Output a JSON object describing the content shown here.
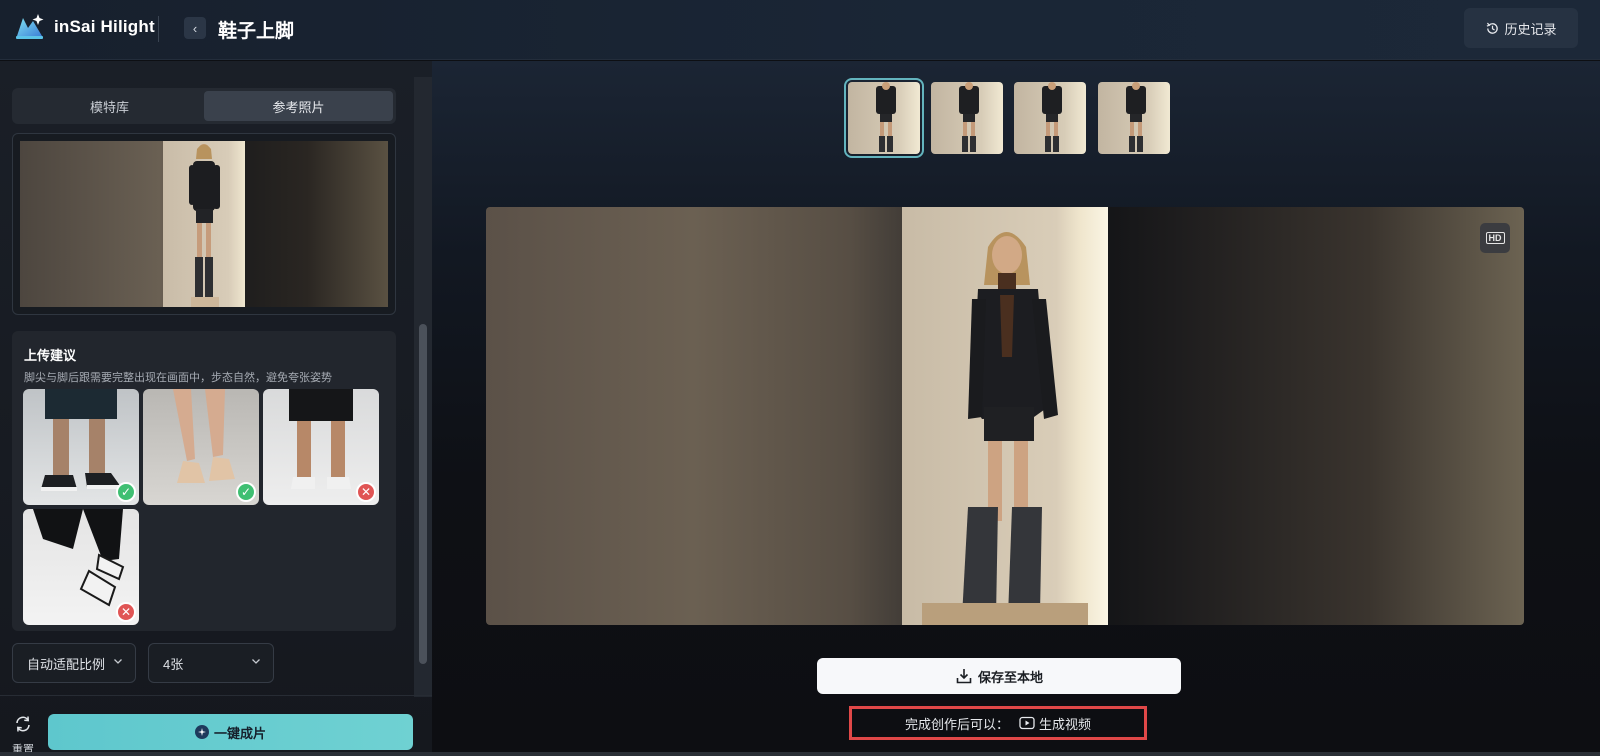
{
  "header": {
    "logo_text": "inSai Hilight",
    "back_icon": "chevron-left-icon",
    "title": "鞋子上脚",
    "history_label": "历史记录",
    "history_icon": "history-clock-icon"
  },
  "left": {
    "tabs": [
      {
        "label": "模特库",
        "active": false
      },
      {
        "label": "参考照片",
        "active": true
      }
    ],
    "tips": {
      "title": "上传建议",
      "description": "脚尖与脚后跟需要完整出现在画面中，步态自然，避免夸张姿势",
      "examples": [
        {
          "status": "ok",
          "icon": "check-icon"
        },
        {
          "status": "ok",
          "icon": "check-icon"
        },
        {
          "status": "bad",
          "icon": "cross-icon"
        },
        {
          "status": "bad",
          "icon": "cross-icon"
        }
      ]
    },
    "ratio_select": {
      "value": "自动适配比例"
    },
    "count_select": {
      "value": "4张"
    },
    "reset_label": "重置",
    "generate_label": "一键成片"
  },
  "main": {
    "thumb_count": 4,
    "hd_label": "HD",
    "save_label": "保存至本地",
    "after_text": "完成创作后可以：",
    "video_label": "生成视频"
  },
  "colors": {
    "accent": "#5ec7cd",
    "highlight_box": "#e04848",
    "ok": "#3fbf72",
    "bad": "#e05555"
  }
}
